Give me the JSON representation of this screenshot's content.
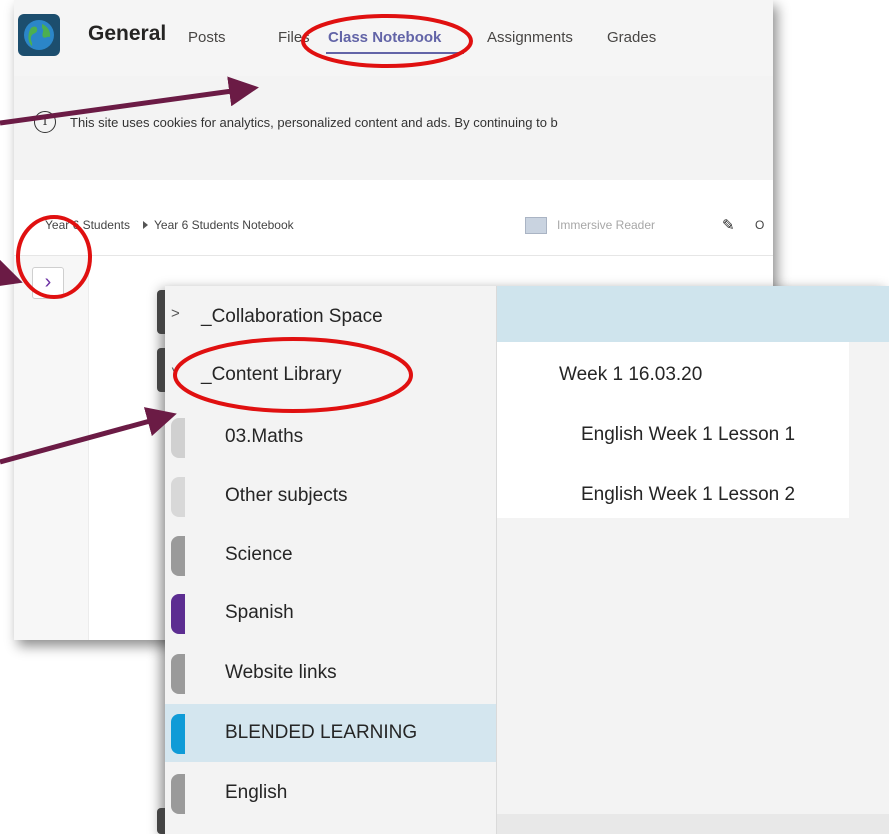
{
  "team": {
    "name": "General"
  },
  "tabs": [
    {
      "label": "Posts"
    },
    {
      "label": "Files"
    },
    {
      "label": "Class Notebook"
    },
    {
      "label": "Assignments"
    },
    {
      "label": "Grades"
    }
  ],
  "cookie_banner": {
    "text": "This site uses cookies for analytics, personalized content and ads. By continuing to b"
  },
  "breadcrumb": [
    {
      "label": "Year 6 Students"
    },
    {
      "label": "Year 6 Students Notebook"
    }
  ],
  "toolbar": {
    "immersive_reader": "Immersive Reader",
    "open_partial": "O"
  },
  "sections": [
    {
      "label": "_Collaboration Space",
      "color": "#3a3a3a"
    },
    {
      "label": "_Content Library",
      "color": "#3a3a3a"
    },
    {
      "label": "03.Maths",
      "color": "#d0d0d0"
    },
    {
      "label": "Other subjects",
      "color": "#d8d8d8"
    },
    {
      "label": "Science",
      "color": "#9a9a9a"
    },
    {
      "label": "Spanish",
      "color": "#5c2d91"
    },
    {
      "label": "Website links",
      "color": "#9a9a9a"
    },
    {
      "label": "BLENDED LEARNING",
      "color": "#0f9bd7"
    },
    {
      "label": "English",
      "color": "#9a9a9a"
    }
  ],
  "pages": [
    {
      "label": "Week 1 16.03.20"
    },
    {
      "label": "English Week 1 Lesson 1"
    },
    {
      "label": "English Week 1 Lesson 2"
    }
  ],
  "colors": {
    "accent": "#6264a7",
    "annotation_circle": "#e01010",
    "annotation_arrow": "#6b1b45"
  }
}
